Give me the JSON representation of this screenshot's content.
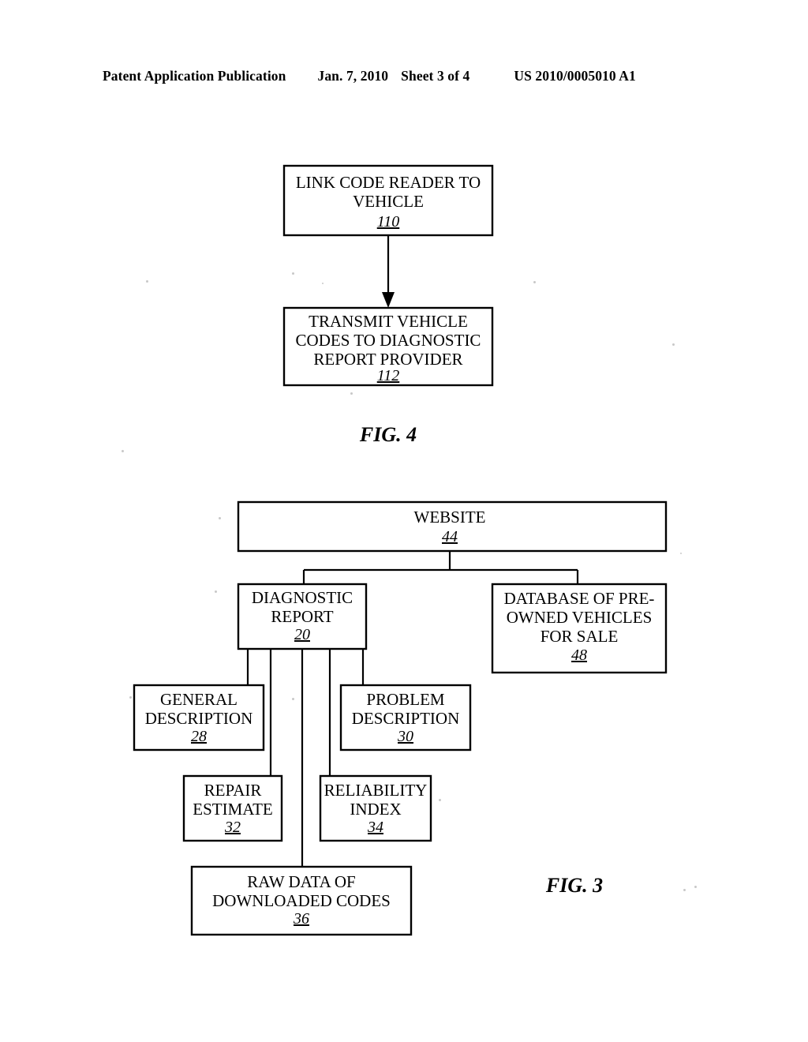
{
  "header": {
    "publication": "Patent Application Publication",
    "date": "Jan. 7, 2010",
    "sheet": "Sheet 3 of 4",
    "patent_number": "US 2010/0005010 A1"
  },
  "figures": [
    {
      "id": "fig4",
      "label": "FIG. 4",
      "type": "flowchart",
      "nodes": [
        {
          "id": "n110",
          "ref": "110",
          "lines": [
            "LINK CODE READER TO",
            "VEHICLE"
          ]
        },
        {
          "id": "n112",
          "ref": "112",
          "lines": [
            "TRANSMIT VEHICLE",
            "CODES TO DIAGNOSTIC",
            "REPORT PROVIDER"
          ]
        }
      ],
      "edges": [
        {
          "from": "n110",
          "to": "n112",
          "arrow": true
        }
      ]
    },
    {
      "id": "fig3",
      "label": "FIG. 3",
      "type": "block-hierarchy",
      "nodes": [
        {
          "id": "n44",
          "ref": "44",
          "lines": [
            "WEBSITE"
          ]
        },
        {
          "id": "n20",
          "ref": "20",
          "lines": [
            "DIAGNOSTIC",
            "REPORT"
          ]
        },
        {
          "id": "n48",
          "ref": "48",
          "lines": [
            "DATABASE OF PRE-",
            "OWNED VEHICLES",
            "FOR SALE"
          ]
        },
        {
          "id": "n28",
          "ref": "28",
          "lines": [
            "GENERAL",
            "DESCRIPTION"
          ]
        },
        {
          "id": "n30",
          "ref": "30",
          "lines": [
            "PROBLEM",
            "DESCRIPTION"
          ]
        },
        {
          "id": "n32",
          "ref": "32",
          "lines": [
            "REPAIR",
            "ESTIMATE"
          ]
        },
        {
          "id": "n34",
          "ref": "34",
          "lines": [
            "RELIABILITY",
            "INDEX"
          ]
        },
        {
          "id": "n36",
          "ref": "36",
          "lines": [
            "RAW DATA OF",
            "DOWNLOADED CODES"
          ]
        }
      ],
      "edges": [
        {
          "from": "n44",
          "to": "n20",
          "arrow": false
        },
        {
          "from": "n44",
          "to": "n48",
          "arrow": false
        },
        {
          "from": "n20",
          "to": "n28",
          "arrow": false
        },
        {
          "from": "n20",
          "to": "n30",
          "arrow": false
        },
        {
          "from": "n20",
          "to": "n32",
          "arrow": false
        },
        {
          "from": "n20",
          "to": "n34",
          "arrow": false
        },
        {
          "from": "n20",
          "to": "n36",
          "arrow": false
        }
      ]
    }
  ],
  "colors": {
    "ink": "#000000",
    "paper": "#ffffff"
  }
}
